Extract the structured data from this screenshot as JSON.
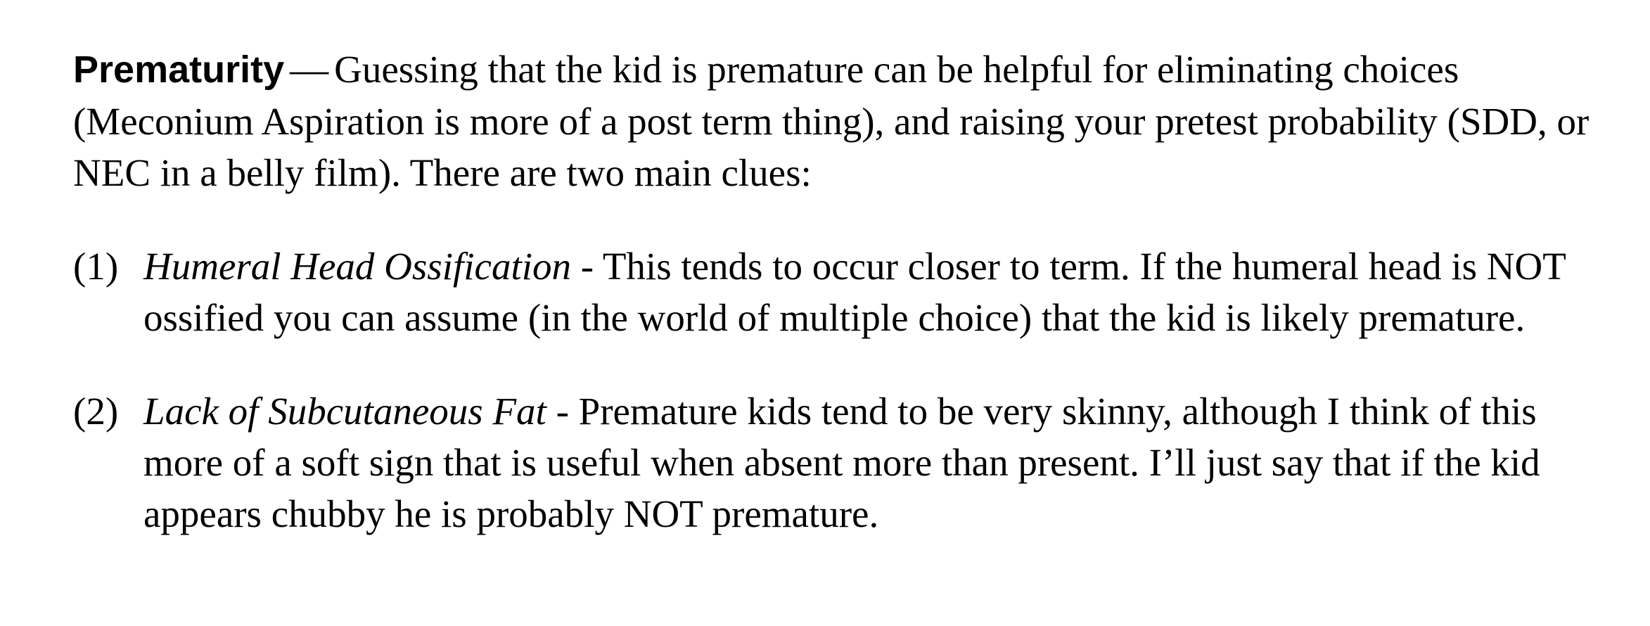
{
  "section": {
    "heading": "Prematurity",
    "separator": "—",
    "intro": "Guessing that the kid is premature can be helpful for eliminating choices (Meconium Aspiration is more of a post term thing), and raising your pretest probability (SDD, or NEC in a belly film).  There are two main clues:"
  },
  "clues": [
    {
      "number": "(1)",
      "term": "Humeral Head Ossification",
      "text": "- This tends to occur closer to term.  If the humeral head is NOT ossified you can assume (in the world of multiple choice) that the kid is likely premature."
    },
    {
      "number": "(2)",
      "term": "Lack of Subcutaneous Fat",
      "text": "- Premature kids tend to be very skinny, although I think of this more of a soft sign that is useful when absent more than present.  I’ll just say that if the kid appears chubby he is probably NOT premature."
    }
  ]
}
